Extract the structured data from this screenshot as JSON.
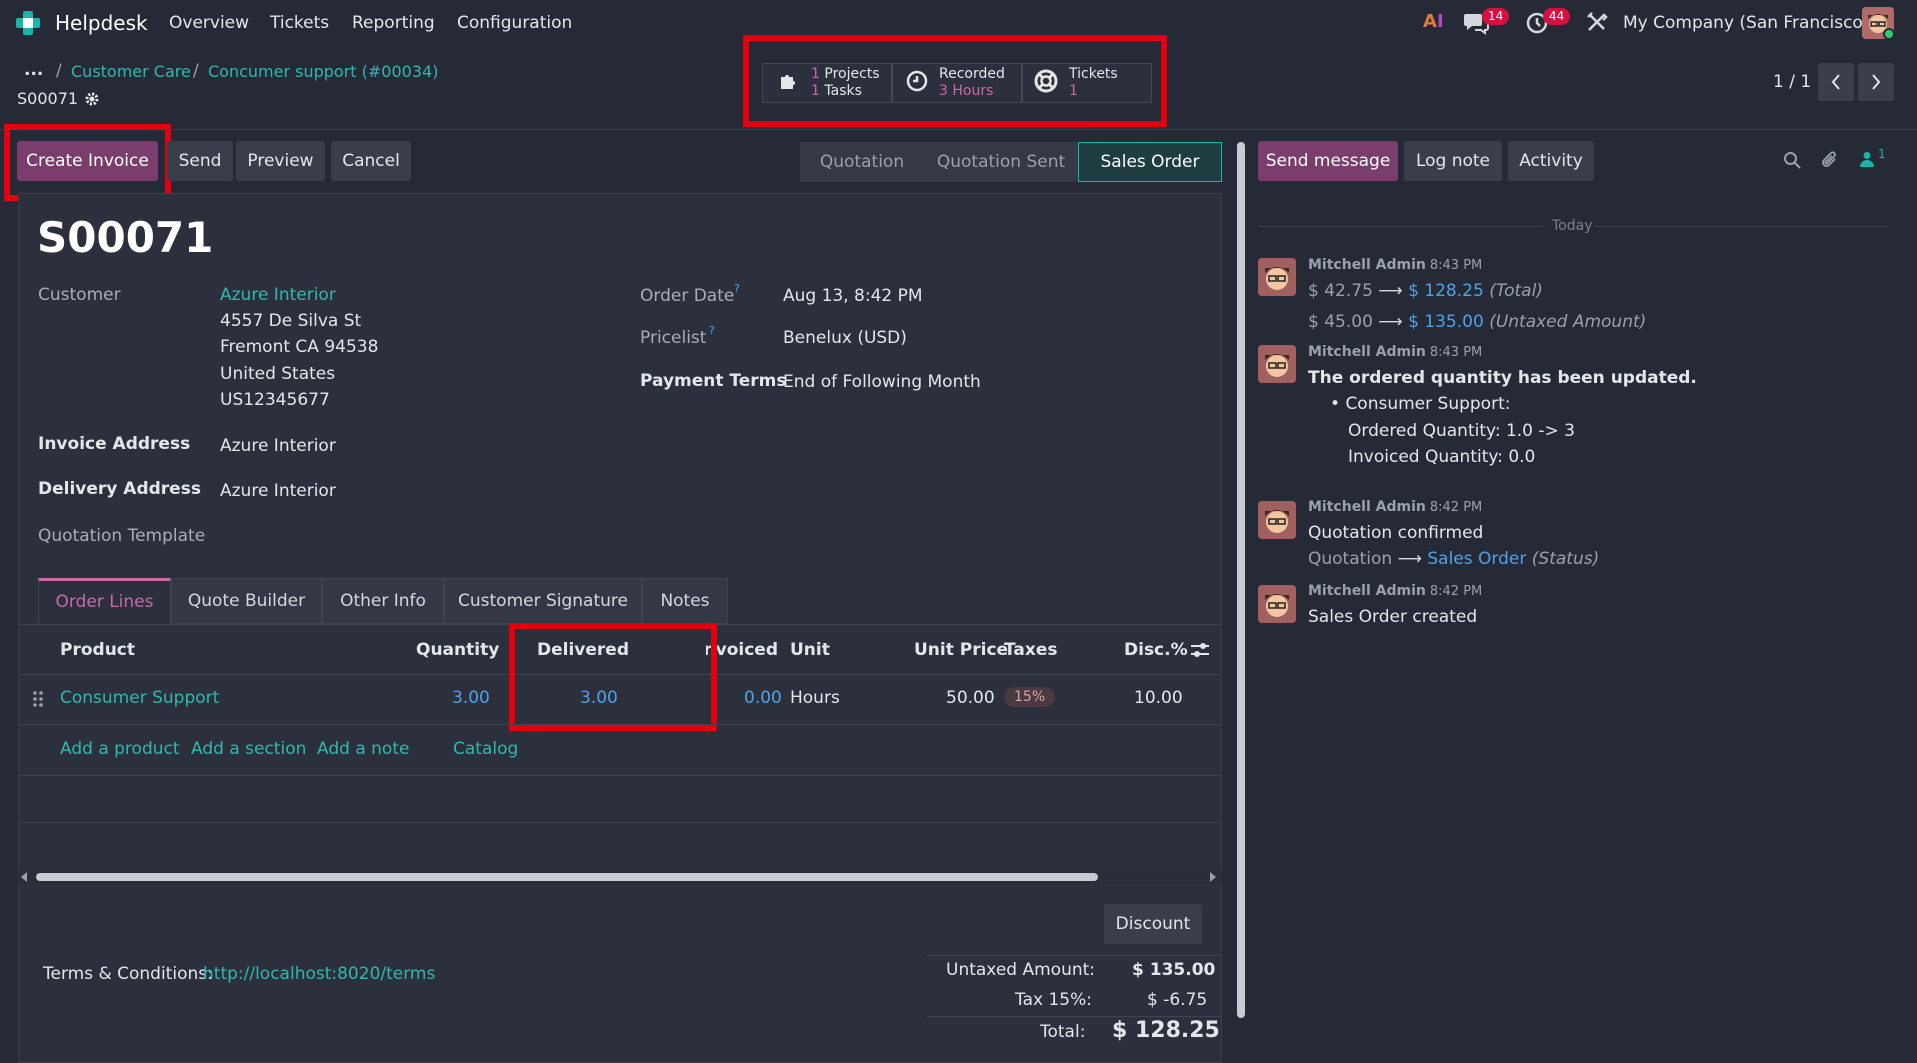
{
  "topbar": {
    "app_name": "Helpdesk",
    "menu": [
      "Overview",
      "Tickets",
      "Reporting",
      "Configuration"
    ],
    "messages_count": "14",
    "activities_count": "44",
    "company": "My Company (San Francisco)"
  },
  "breadcrumb": {
    "ellipsis": "...",
    "items": [
      "Customer Care",
      "Concumer support (#00034)"
    ],
    "current": "S00071"
  },
  "smart_buttons": {
    "projects_count": "1",
    "projects_label": "Projects",
    "tasks_count": "1",
    "tasks_label": "Tasks",
    "recorded_label": "Recorded",
    "recorded_value": "3 Hours",
    "tickets_label": "Tickets",
    "tickets_count": "1"
  },
  "pager": {
    "value": "1 / 1"
  },
  "actions": {
    "create_invoice": "Create Invoice",
    "send": "Send",
    "preview": "Preview",
    "cancel": "Cancel"
  },
  "status_bar": [
    "Quotation",
    "Quotation Sent",
    "Sales Order"
  ],
  "form": {
    "name": "S00071",
    "customer_label": "Customer",
    "customer_name": "Azure Interior",
    "customer_address": [
      "4557 De Silva St",
      "Fremont CA 94538",
      "United States",
      "US12345677"
    ],
    "invoice_address_label": "Invoice Address",
    "invoice_address": "Azure Interior",
    "delivery_address_label": "Delivery Address",
    "delivery_address": "Azure Interior",
    "quotation_template_label": "Quotation Template",
    "order_date_label": "Order Date",
    "order_date": "Aug 13, 8:42 PM",
    "pricelist_label": "Pricelist",
    "pricelist": "Benelux (USD)",
    "payment_terms_label": "Payment Terms",
    "payment_terms": "End of Following Month",
    "help_mark": "?"
  },
  "tabs": [
    "Order Lines",
    "Quote Builder",
    "Other Info",
    "Customer Signature",
    "Notes"
  ],
  "order_lines": {
    "headers": {
      "product": "Product",
      "quantity": "Quantity",
      "delivered": "Delivered",
      "invoiced": "Invoiced",
      "unit": "Unit",
      "unit_price": "Unit Price",
      "taxes": "Taxes",
      "disc": "Disc.%"
    },
    "rows": [
      {
        "product": "Consumer Support",
        "quantity": "3.00",
        "delivered": "3.00",
        "invoiced": "0.00",
        "unit": "Hours",
        "unit_price": "50.00",
        "taxes": "15%",
        "disc": "10.00"
      }
    ],
    "add_product": "Add a product",
    "add_section": "Add a section",
    "add_note": "Add a note",
    "catalog": "Catalog"
  },
  "footer": {
    "discount_button": "Discount",
    "terms_label": "Terms & Conditions:",
    "terms_link": "http://localhost:8020/terms",
    "untaxed_label": "Untaxed Amount:",
    "untaxed_value": "$ 135.00",
    "tax_label": "Tax 15%:",
    "tax_value": "$ -6.75",
    "total_label": "Total:",
    "total_value": "$ 128.25"
  },
  "chatter": {
    "send_message": "Send message",
    "log_note": "Log note",
    "activity": "Activity",
    "followers_count": "1",
    "date_separator": "Today",
    "messages": [
      {
        "author": "Mitchell Admin",
        "time": "8:43 PM",
        "changes": [
          {
            "old": "$ 42.75",
            "new": "$ 128.25",
            "field": "(Total)"
          },
          {
            "old": "$ 45.00",
            "new": "$ 135.00",
            "field": "(Untaxed Amount)"
          }
        ]
      },
      {
        "author": "Mitchell Admin",
        "time": "8:43 PM",
        "title": "The ordered quantity has been updated.",
        "bullet": "Consumer Support:",
        "lines": [
          "Ordered Quantity: 1.0 -> 3",
          "Invoiced Quantity: 0.0"
        ]
      },
      {
        "author": "Mitchell Admin",
        "time": "8:42 PM",
        "body": "Quotation confirmed",
        "change": {
          "old": "Quotation",
          "new": "Sales Order",
          "field": "(Status)"
        }
      },
      {
        "author": "Mitchell Admin",
        "time": "8:42 PM",
        "body": "Sales Order created"
      }
    ]
  },
  "icons": {
    "arrow": "⟶"
  },
  "colors": {
    "primary": "#7b3d6e",
    "link": "#2fb8b0",
    "highlight_box": "#e3000f",
    "badge": "#d3123f"
  }
}
